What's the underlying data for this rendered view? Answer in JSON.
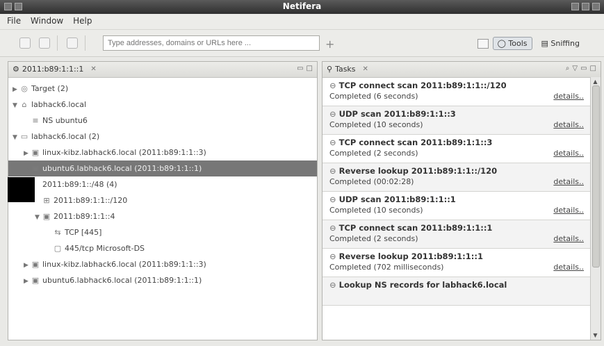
{
  "window": {
    "title": "Netifera"
  },
  "menu": [
    "File",
    "Window",
    "Help"
  ],
  "toolbar": {
    "address_placeholder": "Type addresses, domains or URLs here ...",
    "plus_label": "+",
    "tabs": [
      {
        "label": "Tools",
        "active": true
      },
      {
        "label": "Sniffing",
        "active": false
      }
    ]
  },
  "left_panel": {
    "title": "2011:b89:1:1::1",
    "close": "✕",
    "tree": [
      {
        "label": "Target (2)",
        "indent": 0,
        "twisty": "▶",
        "icon": "target-icon"
      },
      {
        "label": "labhack6.local",
        "indent": 0,
        "twisty": "▼",
        "icon": "domain-icon"
      },
      {
        "label": "NS  ubuntu6",
        "indent": 1,
        "twisty": "",
        "icon": "ns-record-icon"
      },
      {
        "label": "labhack6.local (2)",
        "indent": 0,
        "twisty": "▼",
        "icon": "folder-icon"
      },
      {
        "label": "linux-kibz.labhack6.local (2011:b89:1:1::3)",
        "indent": 1,
        "twisty": "▶",
        "icon": "host-icon"
      },
      {
        "label": "ubuntu6.labhack6.local (2011:b89:1:1::1)",
        "indent": 1,
        "twisty": "▶",
        "icon": "host-icon",
        "selected": true
      },
      {
        "label": "2011:b89:1::/48 (4)",
        "indent": 1,
        "twisty": "",
        "icon": ""
      },
      {
        "label": "2011:b89:1:1::/120",
        "indent": 2,
        "twisty": "",
        "icon": "network-icon"
      },
      {
        "label": "2011:b89:1:1::4",
        "indent": 2,
        "twisty": "▼",
        "icon": "host-icon"
      },
      {
        "label": "TCP [445]",
        "indent": 3,
        "twisty": "",
        "icon": "port-icon"
      },
      {
        "label": "445/tcp Microsoft-DS",
        "indent": 3,
        "twisty": "",
        "icon": "service-icon"
      },
      {
        "label": "linux-kibz.labhack6.local (2011:b89:1:1::3)",
        "indent": 1,
        "twisty": "▶",
        "icon": "host-icon"
      },
      {
        "label": "ubuntu6.labhack6.local (2011:b89:1:1::1)",
        "indent": 1,
        "twisty": "▶",
        "icon": "host-icon"
      }
    ]
  },
  "tasks_panel": {
    "title": "Tasks",
    "close": "✕",
    "details_label": "details..",
    "tasks": [
      {
        "title": "TCP connect scan 2011:b89:1:1::/120",
        "status": "Completed (6 seconds)"
      },
      {
        "title": "UDP scan 2011:b89:1:1::3",
        "status": "Completed (10 seconds)"
      },
      {
        "title": "TCP connect scan 2011:b89:1:1::3",
        "status": "Completed (2 seconds)"
      },
      {
        "title": "Reverse lookup 2011:b89:1:1::/120",
        "status": "Completed (00:02:28)"
      },
      {
        "title": "UDP scan 2011:b89:1:1::1",
        "status": "Completed (10 seconds)"
      },
      {
        "title": "TCP connect scan 2011:b89:1:1::1",
        "status": "Completed (2 seconds)"
      },
      {
        "title": "Reverse lookup 2011:b89:1:1::1",
        "status": "Completed (702 milliseconds)"
      },
      {
        "title": "Lookup NS records for labhack6.local",
        "status": ""
      }
    ]
  }
}
